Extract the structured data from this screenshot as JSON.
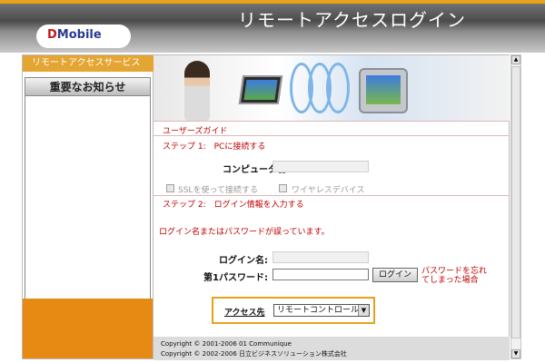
{
  "header": {
    "title": "リモートアクセスログイン"
  },
  "logo": {
    "d": "D",
    "rest": "Mobile"
  },
  "sidebar": {
    "heading": "リモートアクセスサービス",
    "notice_tab": "重要なお知らせ"
  },
  "main": {
    "guide_title": "ユーザーズガイド",
    "step1": "ステップ 1:　PCに接続する",
    "computer_label": "コンピュータ名:",
    "computer_value": "",
    "ssl_label": "SSLを使って接続する",
    "wireless_label": "ワイヤレスデバイス",
    "step2": "ステップ 2:　ログイン情報を入力する",
    "error_message": "ログイン名またはパスワードが誤っています。",
    "login_label": "ログイン名:",
    "login_value": "",
    "password_label": "第1パスワード:",
    "login_button": "ログイン",
    "forgot_password": "パスワードを忘れてしまった場合",
    "destination_label": "アクセス先",
    "destination_selected": "リモートコントロール"
  },
  "footer": {
    "copyright1": "Copyright © 2001-2006 01 Communique",
    "copyright2": "Copyright © 2002-2006 日立ビジネスソリューション株式会社"
  },
  "colors": {
    "accent_orange": "#e8a21a",
    "error_red": "#c00000",
    "sidebar_orange": "#e68a14"
  }
}
